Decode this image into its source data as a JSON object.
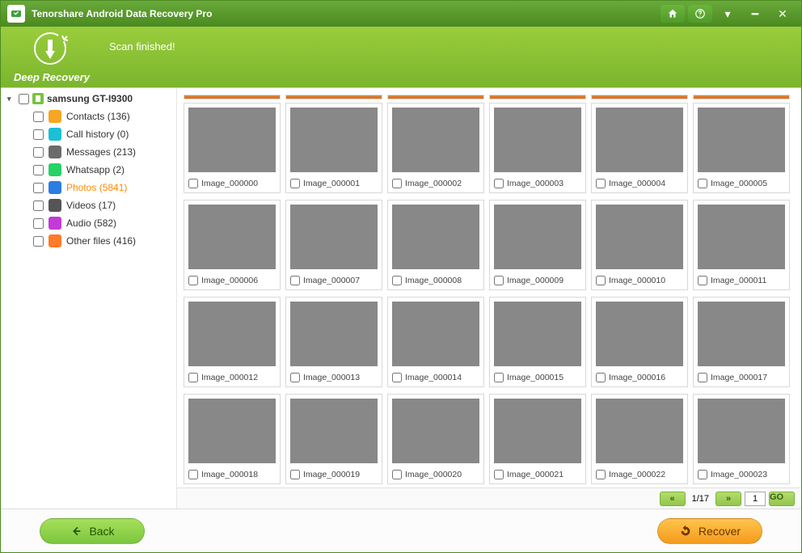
{
  "titlebar": {
    "title": "Tenorshare Android Data Recovery Pro"
  },
  "banner": {
    "deep_recovery_label": "Deep Recovery",
    "status": "Scan finished!"
  },
  "sidebar": {
    "device": "samsung GT-I9300",
    "items": [
      {
        "label": "Contacts (136)",
        "icon": "ic-contacts"
      },
      {
        "label": "Call history (0)",
        "icon": "ic-call"
      },
      {
        "label": "Messages (213)",
        "icon": "ic-msg"
      },
      {
        "label": "Whatsapp (2)",
        "icon": "ic-wa"
      },
      {
        "label": "Photos (5841)",
        "icon": "ic-photo",
        "selected": true
      },
      {
        "label": "Videos (17)",
        "icon": "ic-video"
      },
      {
        "label": "Audio (582)",
        "icon": "ic-audio"
      },
      {
        "label": "Other files (416)",
        "icon": "ic-other"
      }
    ]
  },
  "grid": {
    "items": [
      {
        "name": "Image_000000"
      },
      {
        "name": "Image_000001"
      },
      {
        "name": "Image_000002"
      },
      {
        "name": "Image_000003"
      },
      {
        "name": "Image_000004"
      },
      {
        "name": "Image_000005"
      },
      {
        "name": "Image_000006"
      },
      {
        "name": "Image_000007"
      },
      {
        "name": "Image_000008"
      },
      {
        "name": "Image_000009"
      },
      {
        "name": "Image_000010"
      },
      {
        "name": "Image_000011"
      },
      {
        "name": "Image_000012"
      },
      {
        "name": "Image_000013"
      },
      {
        "name": "Image_000014"
      },
      {
        "name": "Image_000015"
      },
      {
        "name": "Image_000016"
      },
      {
        "name": "Image_000017"
      },
      {
        "name": "Image_000018"
      },
      {
        "name": "Image_000019"
      },
      {
        "name": "Image_000020"
      },
      {
        "name": "Image_000021"
      },
      {
        "name": "Image_000022"
      },
      {
        "name": "Image_000023"
      }
    ]
  },
  "pager": {
    "info": "1/17",
    "go": "GO",
    "input": "1",
    "prev": "«",
    "next": "»"
  },
  "bottom": {
    "back": "Back",
    "recover": "Recover"
  }
}
